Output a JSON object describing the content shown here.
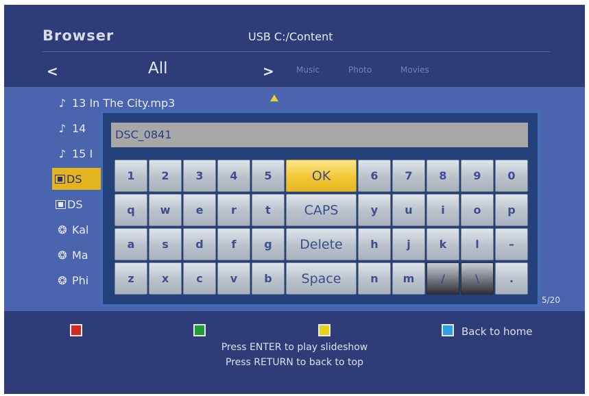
{
  "header": {
    "title": "Browser",
    "path": "USB  C:/Content"
  },
  "nav": {
    "prev": "<",
    "current": "All",
    "next": ">",
    "tabs": [
      "Music",
      "Photo",
      "Movies"
    ]
  },
  "file_list": {
    "items": [
      {
        "icon": "music-note-icon",
        "label": "13 In The City.mp3"
      },
      {
        "icon": "music-note-icon",
        "label": "14"
      },
      {
        "icon": "music-note-icon",
        "label": "15 I"
      },
      {
        "icon": "photo-icon",
        "label": "DS",
        "selected": true
      },
      {
        "icon": "photo-icon",
        "label": "DS"
      },
      {
        "icon": "film-reel-icon",
        "label": "Kal"
      },
      {
        "icon": "film-reel-icon",
        "label": "Ma"
      },
      {
        "icon": "film-reel-icon",
        "label": "Phi"
      }
    ],
    "page_count": "5/20"
  },
  "keyboard": {
    "input_value": "DSC_0841",
    "rows": [
      [
        "1",
        "2",
        "3",
        "4",
        "5",
        "OK",
        "6",
        "7",
        "8",
        "9",
        "0"
      ],
      [
        "q",
        "w",
        "e",
        "r",
        "t",
        "CAPS",
        "y",
        "u",
        "i",
        "o",
        "p"
      ],
      [
        "a",
        "s",
        "d",
        "f",
        "g",
        "Delete",
        "h",
        "j",
        "k",
        "l",
        "–"
      ],
      [
        "z",
        "x",
        "c",
        "v",
        "b",
        "Space",
        "n",
        "m",
        "/",
        "\\",
        "."
      ]
    ],
    "highlighted_key": "OK"
  },
  "footer": {
    "color_buttons": [
      {
        "color": "#d32a1f",
        "label": ""
      },
      {
        "color": "#1f9a3c",
        "label": ""
      },
      {
        "color": "#e7d21e",
        "label": ""
      },
      {
        "color": "#2f9fe0",
        "label": "Back to home"
      }
    ],
    "hint_line1": "Press ENTER to play slideshow",
    "hint_line2": "Press RETURN to back to top"
  }
}
